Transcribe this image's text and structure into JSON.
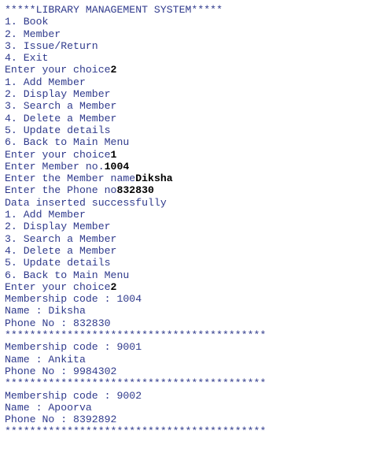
{
  "colors": {
    "program_output": "#2f3a8c",
    "user_input": "#000000",
    "background": "#ffffff"
  },
  "console": {
    "lines": [
      [
        {
          "text": "*****LIBRARY MANAGEMENT SYSTEM*****",
          "kind": "out"
        }
      ],
      [
        {
          "text": "1. Book",
          "kind": "out"
        }
      ],
      [
        {
          "text": "2. Member",
          "kind": "out"
        }
      ],
      [
        {
          "text": "3. Issue/Return",
          "kind": "out"
        }
      ],
      [
        {
          "text": "4. Exit",
          "kind": "out"
        }
      ],
      [
        {
          "text": "Enter your choice",
          "kind": "out"
        },
        {
          "text": "2",
          "kind": "in"
        }
      ],
      [
        {
          "text": "1. Add Member",
          "kind": "out"
        }
      ],
      [
        {
          "text": "2. Display Member",
          "kind": "out"
        }
      ],
      [
        {
          "text": "3. Search a Member",
          "kind": "out"
        }
      ],
      [
        {
          "text": "4. Delete a Member",
          "kind": "out"
        }
      ],
      [
        {
          "text": "5. Update details",
          "kind": "out"
        }
      ],
      [
        {
          "text": "6. Back to Main Menu",
          "kind": "out"
        }
      ],
      [
        {
          "text": "Enter your choice",
          "kind": "out"
        },
        {
          "text": "1",
          "kind": "in"
        }
      ],
      [
        {
          "text": "Enter Member no.",
          "kind": "out"
        },
        {
          "text": "1004",
          "kind": "in"
        }
      ],
      [
        {
          "text": "Enter the Member name",
          "kind": "out"
        },
        {
          "text": "Diksha",
          "kind": "in"
        }
      ],
      [
        {
          "text": "Enter the Phone no",
          "kind": "out"
        },
        {
          "text": "832830",
          "kind": "in"
        }
      ],
      [
        {
          "text": "Data inserted successfully",
          "kind": "out"
        }
      ],
      [
        {
          "text": "1. Add Member",
          "kind": "out"
        }
      ],
      [
        {
          "text": "2. Display Member",
          "kind": "out"
        }
      ],
      [
        {
          "text": "3. Search a Member",
          "kind": "out"
        }
      ],
      [
        {
          "text": "4. Delete a Member",
          "kind": "out"
        }
      ],
      [
        {
          "text": "5. Update details",
          "kind": "out"
        }
      ],
      [
        {
          "text": "6. Back to Main Menu",
          "kind": "out"
        }
      ],
      [
        {
          "text": "Enter your choice",
          "kind": "out"
        },
        {
          "text": "2",
          "kind": "in"
        }
      ],
      [
        {
          "text": "Membership code : 1004",
          "kind": "out"
        }
      ],
      [
        {
          "text": "Name : Diksha",
          "kind": "out"
        }
      ],
      [
        {
          "text": "Phone No : 832830",
          "kind": "out"
        }
      ],
      [
        {
          "text": "******************************************",
          "kind": "out"
        }
      ],
      [
        {
          "text": "Membership code : 9001",
          "kind": "out"
        }
      ],
      [
        {
          "text": "Name : Ankita",
          "kind": "out"
        }
      ],
      [
        {
          "text": "Phone No : 9984302",
          "kind": "out"
        }
      ],
      [
        {
          "text": "******************************************",
          "kind": "out"
        }
      ],
      [
        {
          "text": "Membership code : 9002",
          "kind": "out"
        }
      ],
      [
        {
          "text": "Name : Apoorva",
          "kind": "out"
        }
      ],
      [
        {
          "text": "Phone No : 8392892",
          "kind": "out"
        }
      ],
      [
        {
          "text": "******************************************",
          "kind": "out"
        }
      ]
    ]
  }
}
